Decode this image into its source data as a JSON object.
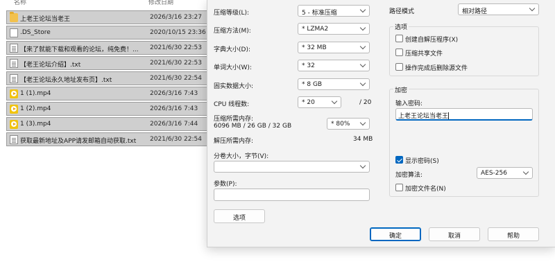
{
  "explorer": {
    "columns": {
      "name": "名称",
      "date": "修改日期"
    },
    "rows": [
      {
        "name": "上老王论坛当老王",
        "date": "2026/3/16 23:27",
        "icon": "folder-icon"
      },
      {
        "name": ".DS_Store",
        "date": "2020/10/15 23:36",
        "icon": "file-icon"
      },
      {
        "name": "【来了就能下载和观看的论坛，纯免费！...",
        "date": "2021/6/30 22:53",
        "icon": "text-file-icon"
      },
      {
        "name": "【老王论坛介绍】.txt",
        "date": "2021/6/30 22:53",
        "icon": "text-file-icon"
      },
      {
        "name": "【老王论坛永久地址发布页】.txt",
        "date": "2021/6/30 22:54",
        "icon": "text-file-icon"
      },
      {
        "name": "1 (1).mp4",
        "date": "2026/3/16 7:43",
        "icon": "video-file-icon"
      },
      {
        "name": "1 (2).mp4",
        "date": "2026/3/16 7:43",
        "icon": "video-file-icon"
      },
      {
        "name": "1 (3).mp4",
        "date": "2026/3/16 7:44",
        "icon": "video-file-icon"
      },
      {
        "name": "获取最新地址及APP请发邮箱自动获取.txt",
        "date": "2021/6/30 22:54",
        "icon": "text-file-icon"
      }
    ]
  },
  "dialog": {
    "compression_level": {
      "label": "压缩等级(L):",
      "value": "5 - 标准压缩"
    },
    "compression_method": {
      "label": "压缩方法(M):",
      "value": "* LZMA2"
    },
    "dictionary_size": {
      "label": "字典大小(D):",
      "value": "* 32 MB"
    },
    "word_size": {
      "label": "单词大小(W):",
      "value": "* 32"
    },
    "solid_block_size": {
      "label": "固实数据大小:",
      "value": "* 8 GB"
    },
    "cpu_threads": {
      "label": "CPU 线程数:",
      "value": "* 20",
      "max": "/ 20"
    },
    "memory_compress": {
      "label": "压缩所需内存:",
      "detail": "6096 MB / 26 GB / 32 GB",
      "value": "* 80%"
    },
    "memory_decompress": {
      "label": "解压所需内存:",
      "value": "34 MB"
    },
    "split_volume": {
      "label": "分卷大小，字节(V):",
      "value": ""
    },
    "parameters": {
      "label": "参数(P):",
      "value": ""
    },
    "options_button": "选项",
    "path_mode": {
      "label": "路径模式",
      "value": "相对路径"
    },
    "options_group": {
      "title": "选项",
      "create_sfx": "创建自解压程序(X)",
      "compress_shared": "压缩共享文件",
      "delete_after": "操作完成后删除源文件"
    },
    "encryption_group": {
      "title": "加密",
      "password_label": "输入密码:",
      "password_value": "上老王论坛当老王",
      "show_password": "显示密码(S)",
      "method_label": "加密算法:",
      "method_value": "AES-256",
      "encrypt_names": "加密文件名(N)"
    },
    "buttons": {
      "ok": "确定",
      "cancel": "取消",
      "help": "帮助"
    }
  },
  "colors": {
    "accent": "#0067c0",
    "folder": "#f2c14e",
    "video": "#f1c40f",
    "selection": "#cfcfcf"
  }
}
